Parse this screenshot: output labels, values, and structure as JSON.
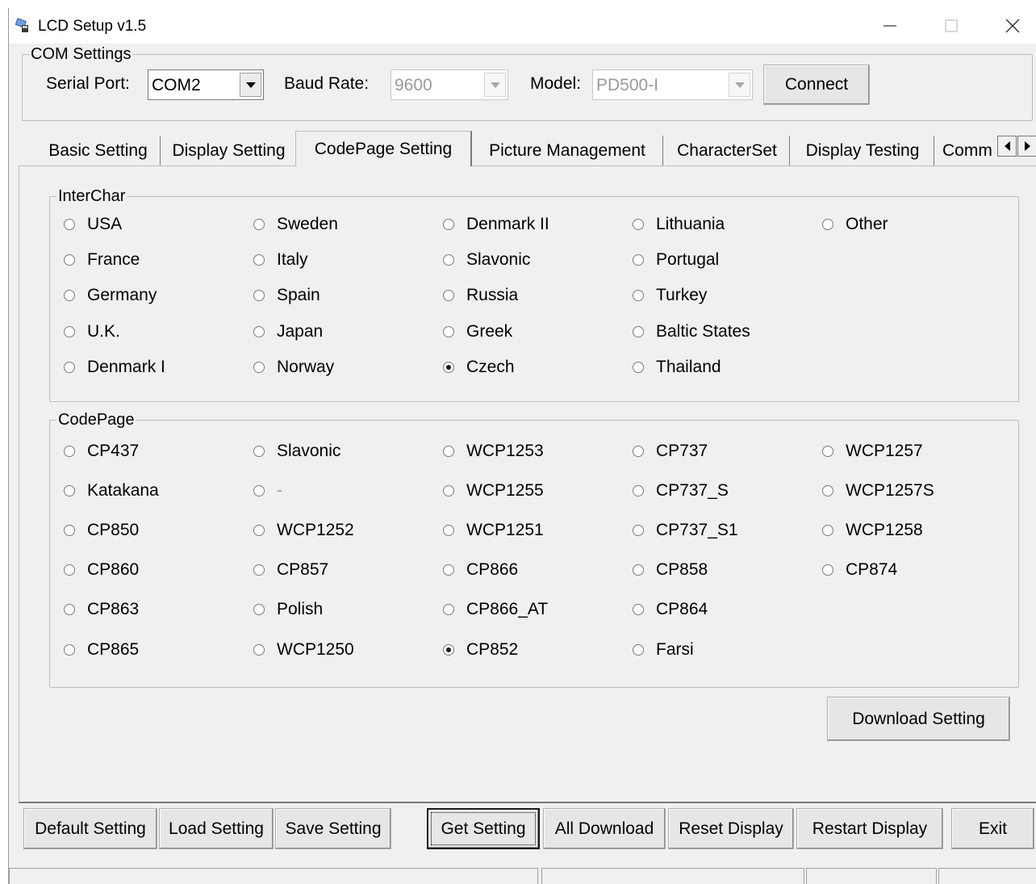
{
  "window": {
    "title": "LCD Setup v1.5",
    "app_icon": "lcd-app-icon",
    "controls": [
      "minimize-icon",
      "maximize-icon",
      "close-icon"
    ]
  },
  "com_settings": {
    "legend": "COM Settings",
    "serial_port_label": "Serial Port:",
    "serial_port_value": "COM2",
    "baud_rate_label": "Baud Rate:",
    "baud_rate_value": "9600",
    "model_label": "Model:",
    "model_value": "PD500-I",
    "connect_label": "Connect"
  },
  "tabs": [
    {
      "label": "Basic Setting",
      "active": false
    },
    {
      "label": "Display Setting",
      "active": false
    },
    {
      "label": "CodePage Setting",
      "active": true
    },
    {
      "label": "Picture Management",
      "active": false
    },
    {
      "label": "CharacterSet",
      "active": false
    },
    {
      "label": "Display Testing",
      "active": false
    },
    {
      "label": "Comm",
      "active": false
    }
  ],
  "interchar": {
    "legend": "InterChar",
    "options": [
      [
        "USA",
        "France",
        "Germany",
        "U.K.",
        "Denmark I"
      ],
      [
        "Sweden",
        "Italy",
        "Spain",
        "Japan",
        "Norway"
      ],
      [
        "Denmark II",
        "Slavonic",
        "Russia",
        "Greek",
        "Czech"
      ],
      [
        "Lithuania",
        "Portugal",
        "Turkey",
        "Baltic States",
        "Thailand"
      ],
      [
        "Other"
      ]
    ],
    "selected": "Czech"
  },
  "codepage": {
    "legend": "CodePage",
    "options": [
      [
        "CP437",
        "Katakana",
        "CP850",
        "CP860",
        "CP863",
        "CP865"
      ],
      [
        "Slavonic",
        "-",
        "WCP1252",
        "CP857",
        "Polish",
        "WCP1250"
      ],
      [
        "WCP1253",
        "WCP1255",
        "WCP1251",
        "CP866",
        "CP866_AT",
        "CP852"
      ],
      [
        "CP737",
        "CP737_S",
        "CP737_S1",
        "CP858",
        "CP864",
        "Farsi"
      ],
      [
        "WCP1257",
        "WCP1257S",
        "WCP1258",
        "CP874"
      ]
    ],
    "selected": "CP852",
    "disabled": [
      "-"
    ]
  },
  "download_setting_label": "Download Setting",
  "bottom_buttons": {
    "default_setting": "Default Setting",
    "load_setting": "Load Setting",
    "save_setting": "Save Setting",
    "get_setting": "Get Setting",
    "all_download": "All Download",
    "reset_display": "Reset Display",
    "restart_display": "Restart Display",
    "exit": "Exit"
  },
  "statusbar": {
    "panels": [
      "",
      "",
      "",
      ""
    ]
  }
}
